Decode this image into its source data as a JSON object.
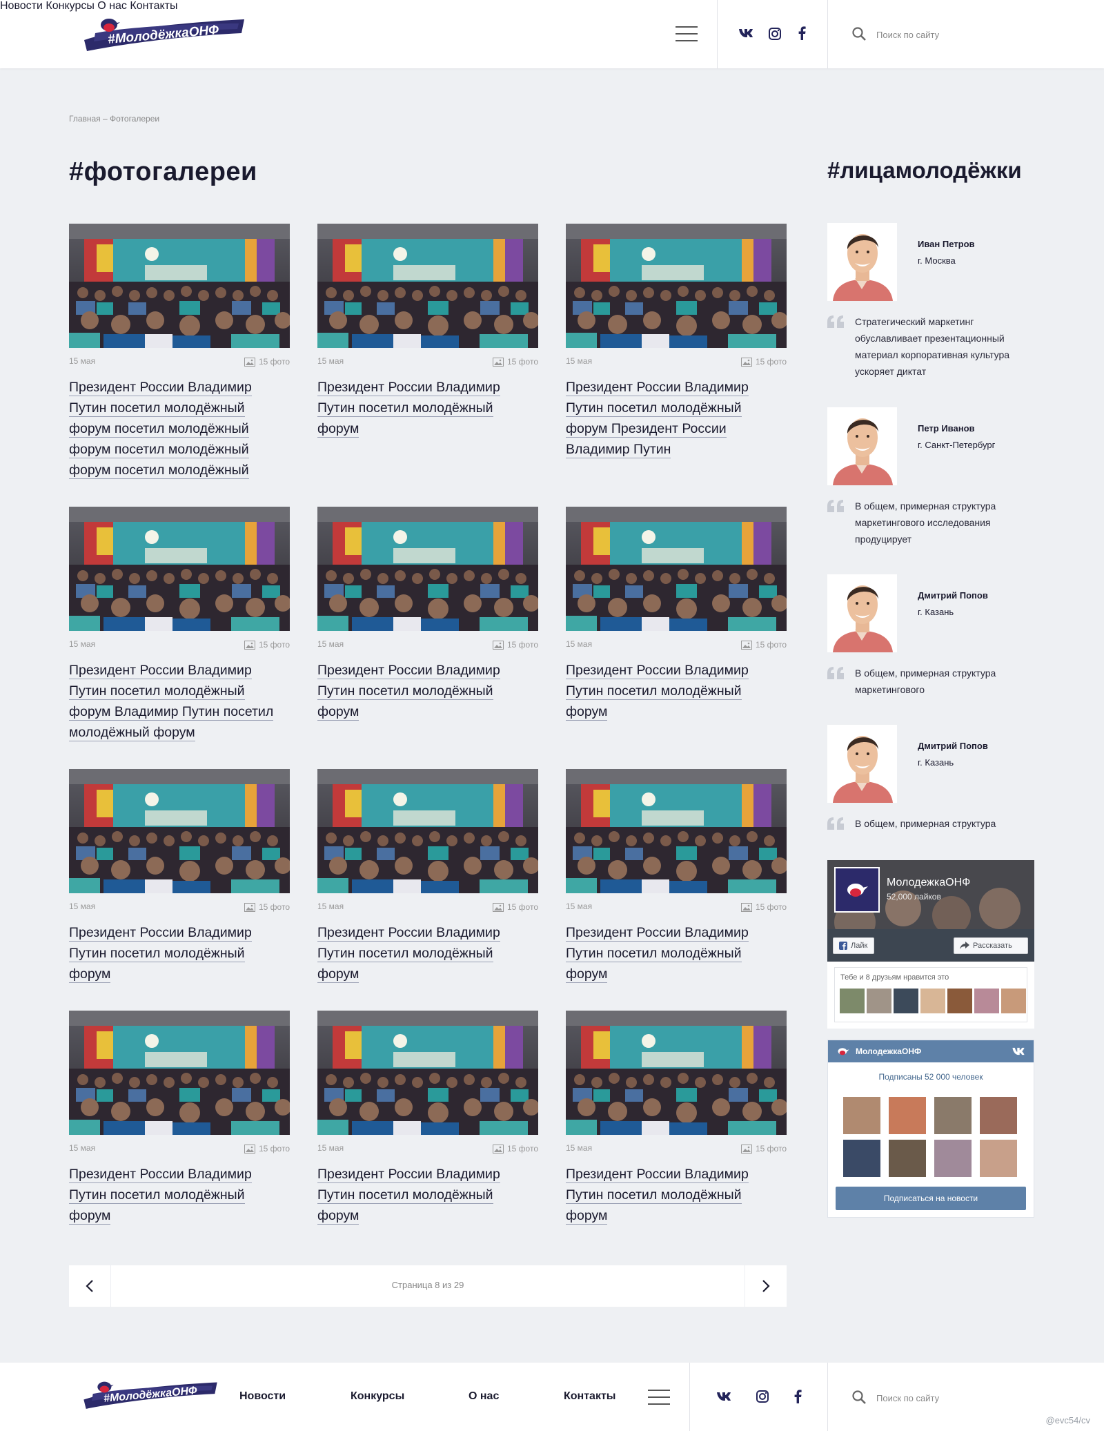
{
  "header": {
    "nav": [
      "Новости",
      "Конкурсы",
      "О нас",
      "Контакты"
    ],
    "search_placeholder": "Поиск по сайту"
  },
  "breadcrumb": "Главная – Фотогалереи",
  "page_title": "#фотогалереи",
  "side_title": "#лицамолодёжки",
  "gallery": [
    {
      "date": "15 мая",
      "count": "15 фото",
      "title": "Президент России Владимир Путин посетил молодёжный форум посетил молодёжный форум посетил молодёжный форум посетил молодёжный"
    },
    {
      "date": "15 мая",
      "count": "15 фото",
      "title": "Президент России Владимир Путин посетил молодёжный форум"
    },
    {
      "date": "15 мая",
      "count": "15 фото",
      "title": "Президент России Владимир Путин посетил молодёжный форум Президент России Владимир Путин"
    },
    {
      "date": "15 мая",
      "count": "15 фото",
      "title": "Президент России Владимир Путин посетил молодёжный форум Владимир Путин посетил молодёжный форум"
    },
    {
      "date": "15 мая",
      "count": "15 фото",
      "title": "Президент России Владимир Путин посетил молодёжный форум"
    },
    {
      "date": "15 мая",
      "count": "15 фото",
      "title": "Президент России Владимир Путин посетил молодёжный форум"
    },
    {
      "date": "15 мая",
      "count": "15 фото",
      "title": "Президент России Владимир Путин посетил молодёжный форум"
    },
    {
      "date": "15 мая",
      "count": "15 фото",
      "title": "Президент России Владимир Путин посетил молодёжный форум"
    },
    {
      "date": "15 мая",
      "count": "15 фото",
      "title": "Президент России Владимир Путин посетил молодёжный форум"
    },
    {
      "date": "15 мая",
      "count": "15 фото",
      "title": "Президент России Владимир Путин посетил молодёжный форум"
    },
    {
      "date": "15 мая",
      "count": "15 фото",
      "title": "Президент России Владимир Путин посетил молодёжный форум"
    },
    {
      "date": "15 мая",
      "count": "15 фото",
      "title": "Президент России Владимир Путин посетил молодёжный форум"
    }
  ],
  "pager": {
    "label": "Страница 8 из 29"
  },
  "faces": [
    {
      "name": "Иван Петров",
      "city": "г. Москва",
      "text": "Стратегический маркетинг обуславливает презентационный материал корпоративная культура ускоряет диктат"
    },
    {
      "name": "Петр Иванов",
      "city": "г. Санкт-Петербург",
      "text": "В общем, примерная структура маркетингового исследования продуцирует"
    },
    {
      "name": "Дмитрий Попов",
      "city": "г. Казань",
      "text": "В общем, примерная структура маркетингового"
    },
    {
      "name": "Дмитрий Попов",
      "city": "г. Казань",
      "text": "В общем, примерная структура"
    }
  ],
  "fb_widget": {
    "page_name": "МолодежкаОНФ",
    "likes": "52,000 лайков",
    "like_btn": "Лайк",
    "share_btn": "Рассказать",
    "friends_text": "Тебе и 8 друзьям нравится это"
  },
  "vk_widget": {
    "page_name": "МолодежкаОНФ",
    "subscribers": "Подписаны 52 000 человек",
    "subscribe_btn": "Подписаться на новости"
  },
  "footer": {
    "nav": [
      "Новости",
      "Конкурсы",
      "О нас",
      "Контакты"
    ],
    "search_placeholder": "Поиск по сайту"
  },
  "watermark": "@evc54/cv",
  "colors": {
    "brand": "#2c2a6a",
    "accent_red": "#d7263d",
    "vk_blue": "#5e81a8",
    "bg": "#eef0f3"
  }
}
